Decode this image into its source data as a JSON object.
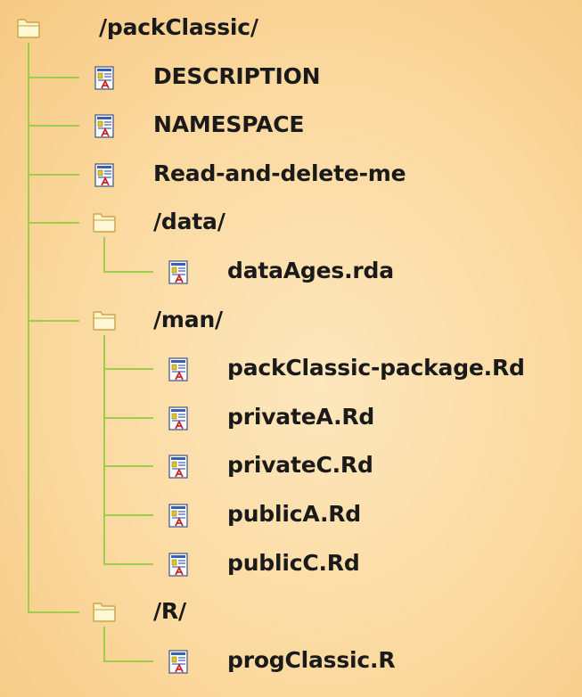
{
  "tree": {
    "type": "folder",
    "name": "/packClassic/",
    "icon": "folder-icon",
    "children": [
      {
        "type": "file",
        "name": "DESCRIPTION",
        "icon": "document-icon"
      },
      {
        "type": "file",
        "name": "NAMESPACE",
        "icon": "document-icon"
      },
      {
        "type": "file",
        "name": "Read-and-delete-me",
        "icon": "document-icon"
      },
      {
        "type": "folder",
        "name": "/data/",
        "icon": "folder-icon",
        "children": [
          {
            "type": "file",
            "name": "dataAges.rda",
            "icon": "document-icon"
          }
        ]
      },
      {
        "type": "folder",
        "name": "/man/",
        "icon": "folder-icon",
        "children": [
          {
            "type": "file",
            "name": "packClassic-package.Rd",
            "icon": "document-icon"
          },
          {
            "type": "file",
            "name": "privateA.Rd",
            "icon": "document-icon"
          },
          {
            "type": "file",
            "name": "privateC.Rd",
            "icon": "document-icon"
          },
          {
            "type": "file",
            "name": "publicA.Rd",
            "icon": "document-icon"
          },
          {
            "type": "file",
            "name": "publicC.Rd",
            "icon": "document-icon"
          }
        ]
      },
      {
        "type": "folder",
        "name": "/R/",
        "icon": "folder-icon",
        "children": [
          {
            "type": "file",
            "name": "progClassic.R",
            "icon": "document-icon"
          }
        ]
      }
    ]
  },
  "colors": {
    "background": "#fbd99f",
    "connector": "#9fcc4a",
    "text": "#1a1a1a",
    "folder_fill": "#fdf3c4",
    "folder_edge": "#c9a64a"
  }
}
